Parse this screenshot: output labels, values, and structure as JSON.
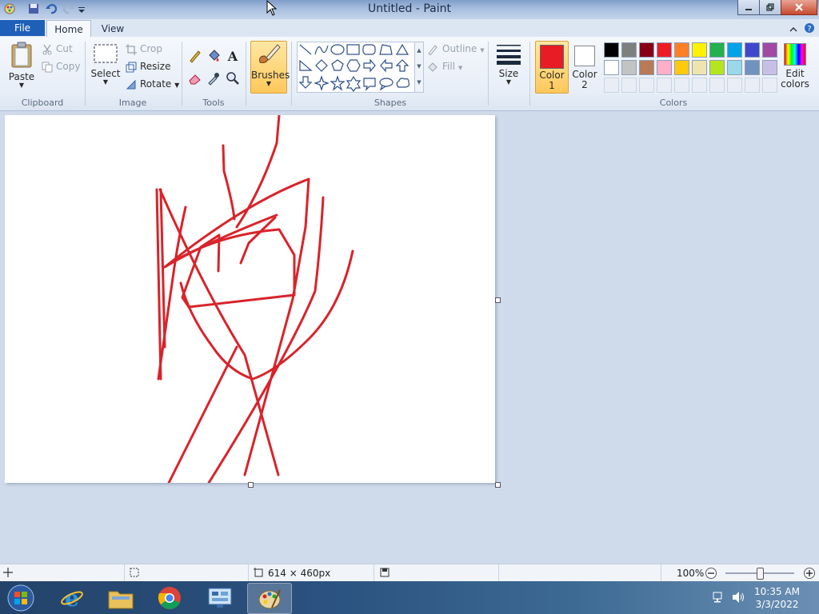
{
  "window": {
    "title": "Untitled - Paint"
  },
  "tabs": {
    "file": "File",
    "home": "Home",
    "view": "View"
  },
  "clipboard": {
    "paste": "Paste",
    "cut": "Cut",
    "copy": "Copy",
    "group": "Clipboard"
  },
  "image": {
    "select": "Select",
    "crop": "Crop",
    "resize": "Resize",
    "rotate": "Rotate",
    "group": "Image"
  },
  "tools": {
    "group": "Tools"
  },
  "brushes": {
    "label": "Brushes"
  },
  "shapes": {
    "outline": "Outline",
    "fill": "Fill",
    "group": "Shapes"
  },
  "size": {
    "label": "Size"
  },
  "colors": {
    "color1_line1": "Color",
    "color1_line2": "1",
    "color2_line1": "Color",
    "color2_line2": "2",
    "edit_line1": "Edit",
    "edit_line2": "colors",
    "group": "Colors",
    "color1": "#e81c24",
    "color2": "#ffffff",
    "row1": [
      "#000000",
      "#7f7f7f",
      "#880015",
      "#ed1c24",
      "#ff7f27",
      "#fff200",
      "#22b14c",
      "#00a2e8",
      "#3f48cc",
      "#a349a4"
    ],
    "row2": [
      "#ffffff",
      "#c3c3c3",
      "#b97a57",
      "#ffaec9",
      "#ffc90e",
      "#efe4b0",
      "#b5e61d",
      "#99d9ea",
      "#7092be",
      "#c8bfe7"
    ]
  },
  "status": {
    "dimensions": "614 × 460px",
    "zoom": "100%",
    "zoom_level": 0.5
  },
  "taskbar": {
    "time": "10:35 AM",
    "date": "3/3/2022"
  },
  "accent": {
    "stroke": "#d9232a",
    "file_tab": "#1e5fb8"
  }
}
